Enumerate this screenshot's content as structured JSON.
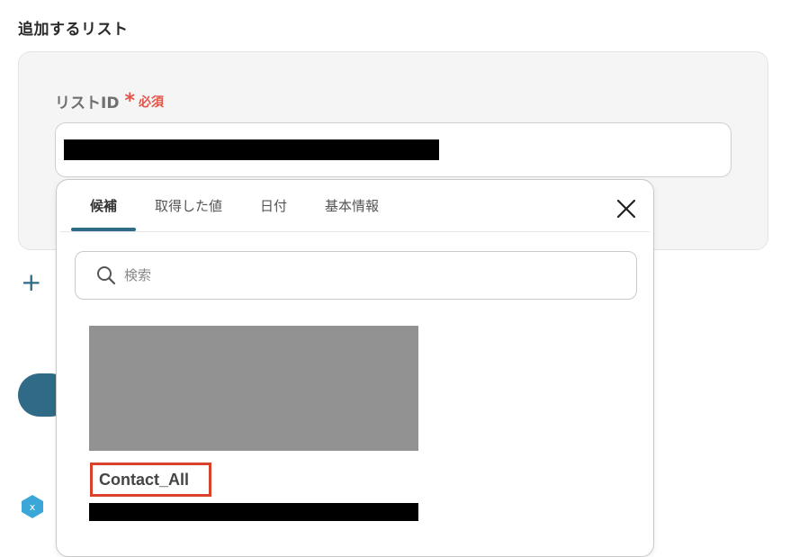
{
  "section": {
    "title": "追加するリスト"
  },
  "field": {
    "label": "リストID",
    "required_mark": "*",
    "required_text": "必須"
  },
  "add_button": {
    "icon": "plus-icon"
  },
  "dropdown": {
    "tabs": [
      {
        "label": "候補",
        "active": true
      },
      {
        "label": "取得した値",
        "active": false
      },
      {
        "label": "日付",
        "active": false
      },
      {
        "label": "基本情報",
        "active": false
      }
    ],
    "close_icon": "close-icon",
    "search": {
      "placeholder": "検索",
      "value": ""
    },
    "options": [
      {
        "label": "Contact_All"
      }
    ]
  },
  "colors": {
    "accent": "#2f6b86",
    "required": "#e2554a",
    "highlight_border": "#d9412b",
    "card_bg": "#f5f5f5"
  }
}
